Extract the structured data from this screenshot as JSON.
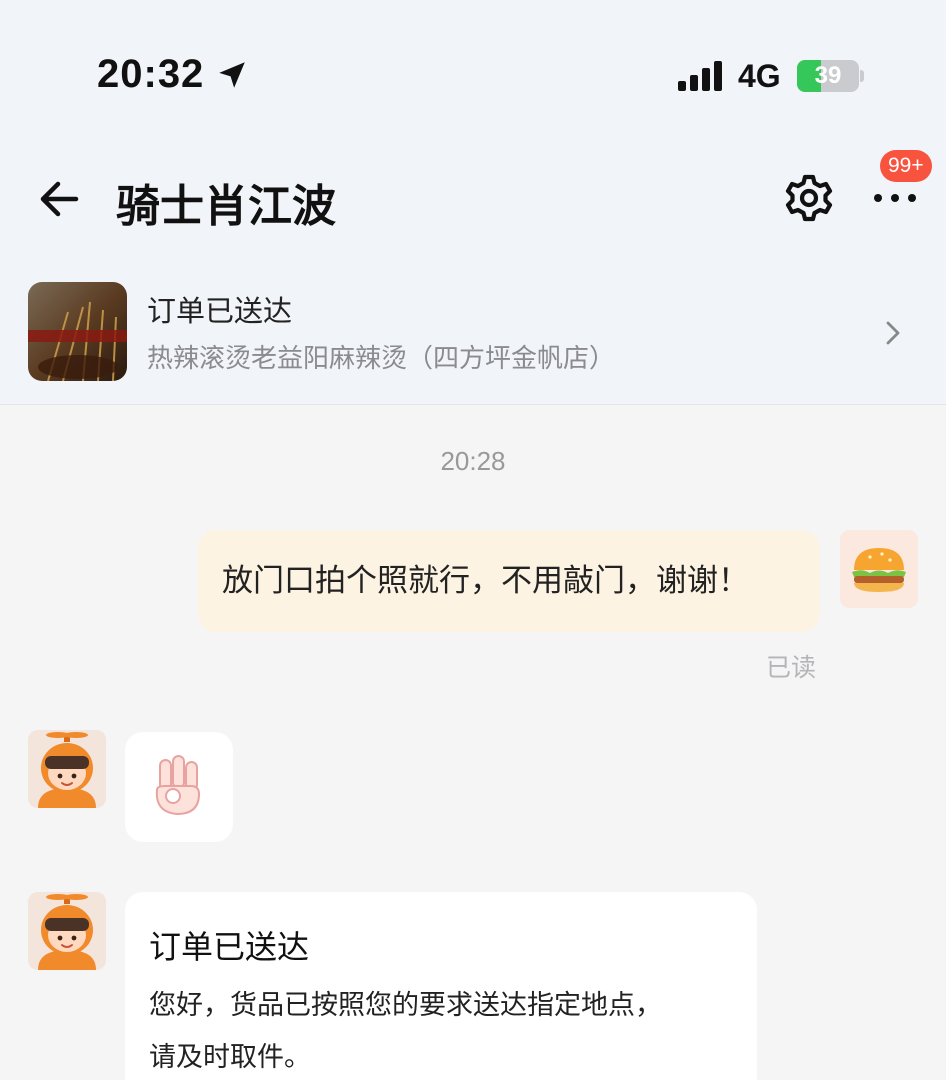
{
  "status_bar": {
    "time": "20:32",
    "network": "4G",
    "battery_percent": "39",
    "battery_level": 0.39
  },
  "nav": {
    "title": "骑士肖江波",
    "badge": "99+",
    "back_icon": "arrow-left-icon",
    "settings_icon": "gear-icon",
    "more_icon": "ellipsis-icon"
  },
  "order_card": {
    "status": "订单已送达",
    "shop_name": "热辣滚烫老益阳麻辣烫（四方坪金帆店）"
  },
  "chat": {
    "timestamp": "20:28",
    "outgoing_message": "放门口拍个照就行，不用敲门，谢谢！",
    "read_status": "已读",
    "sticker": "ok-hand-sticker",
    "notice": {
      "title": "订单已送达",
      "line1": "您好，货品已按照您的要求送达指定地点，",
      "line2": "请及时取件。"
    }
  },
  "colors": {
    "outgoing_bubble": "#fdf3e2",
    "badge": "#f8533f",
    "battery_fill": "#35c759",
    "header_bg": "#f1f4f8"
  }
}
